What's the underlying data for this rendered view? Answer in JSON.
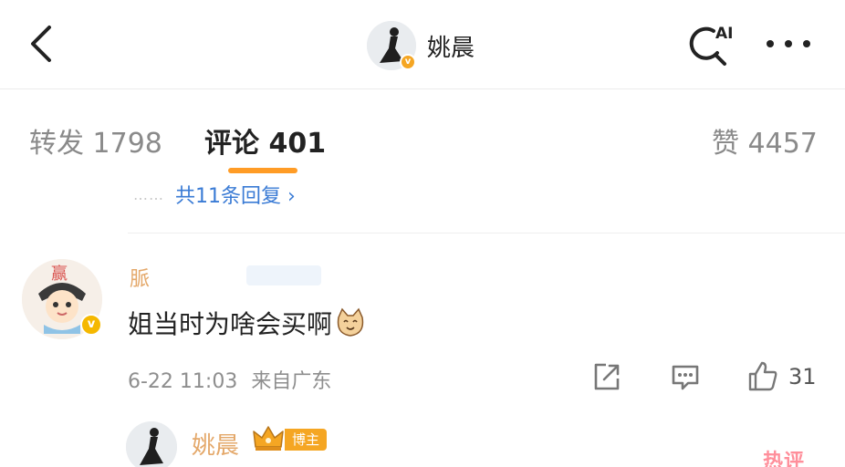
{
  "header": {
    "back_icon": "chevron-left-icon",
    "title": "姚晨",
    "avatar_icon": "person-silhouette-icon",
    "verified_icon": "verified-badge-icon",
    "verified_mark": "v",
    "ai_search_icon": "ai-search-icon",
    "ai_label": "AI",
    "more_icon": "more-dots-icon"
  },
  "tabs": [
    {
      "label": "转发 1798"
    },
    {
      "label": "评论 401"
    },
    {
      "label": "赞 4457"
    }
  ],
  "active_tab_index": 1,
  "reply_thread": {
    "dots": "……",
    "more_replies_label": "共11条回复 ›"
  },
  "comment": {
    "username": "脈",
    "text": "姐当时为啥会买啊",
    "emoji_icon": "cat-face-emoji-icon",
    "avatar_text": "赢",
    "timestamp": "6-22 11:03",
    "location": "来自广东",
    "like_count": "31",
    "share_icon": "share-icon",
    "comment_icon": "comment-icon",
    "like_icon": "thumbs-up-icon"
  },
  "reply": {
    "username": "姚晨",
    "crown_icon": "crown-icon",
    "badge": "博主",
    "hot_label": "热评"
  },
  "colors": {
    "accent_orange": "#ff9c26",
    "link_blue": "#3a7bd5",
    "name_gold": "#e4a86a",
    "verified_gold": "#f5a623"
  }
}
